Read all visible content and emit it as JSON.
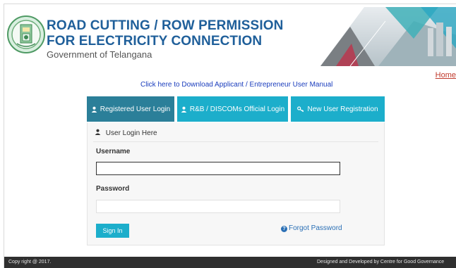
{
  "header": {
    "title_line1": "ROAD CUTTING / ROW PERMISSION",
    "title_line2": "FOR ELECTRICITY CONNECTION",
    "subtitle": "Government of Telangana",
    "home_link": "Home",
    "emblem_icon": "telangana-emblem-icon"
  },
  "manual_link": "Click here to Download Applicant / Entrepreneur User Manual",
  "tabs": [
    {
      "label": "Registered User Login",
      "icon": "user-icon",
      "active": true
    },
    {
      "label": "R&B / DISCOMs Official Login",
      "icon": "user-icon",
      "active": false
    },
    {
      "label": "New User Registration",
      "icon": "key-icon",
      "active": false
    }
  ],
  "login": {
    "heading": "User Login Here",
    "username_label": "Username",
    "username_value": "",
    "password_label": "Password",
    "password_value": "",
    "signin_label": "Sign In",
    "forgot_label": "Forgot Password"
  },
  "footer": {
    "copyright": "Copy right @ 2017.",
    "credit": "Designed and Developed by Centre for Good Governance"
  },
  "colors": {
    "brand_blue": "#1f5f9a",
    "tab_active": "#2b7f99",
    "tab": "#1caecb",
    "footer_bg": "#2f2f2f",
    "home_link": "#c0392b"
  }
}
